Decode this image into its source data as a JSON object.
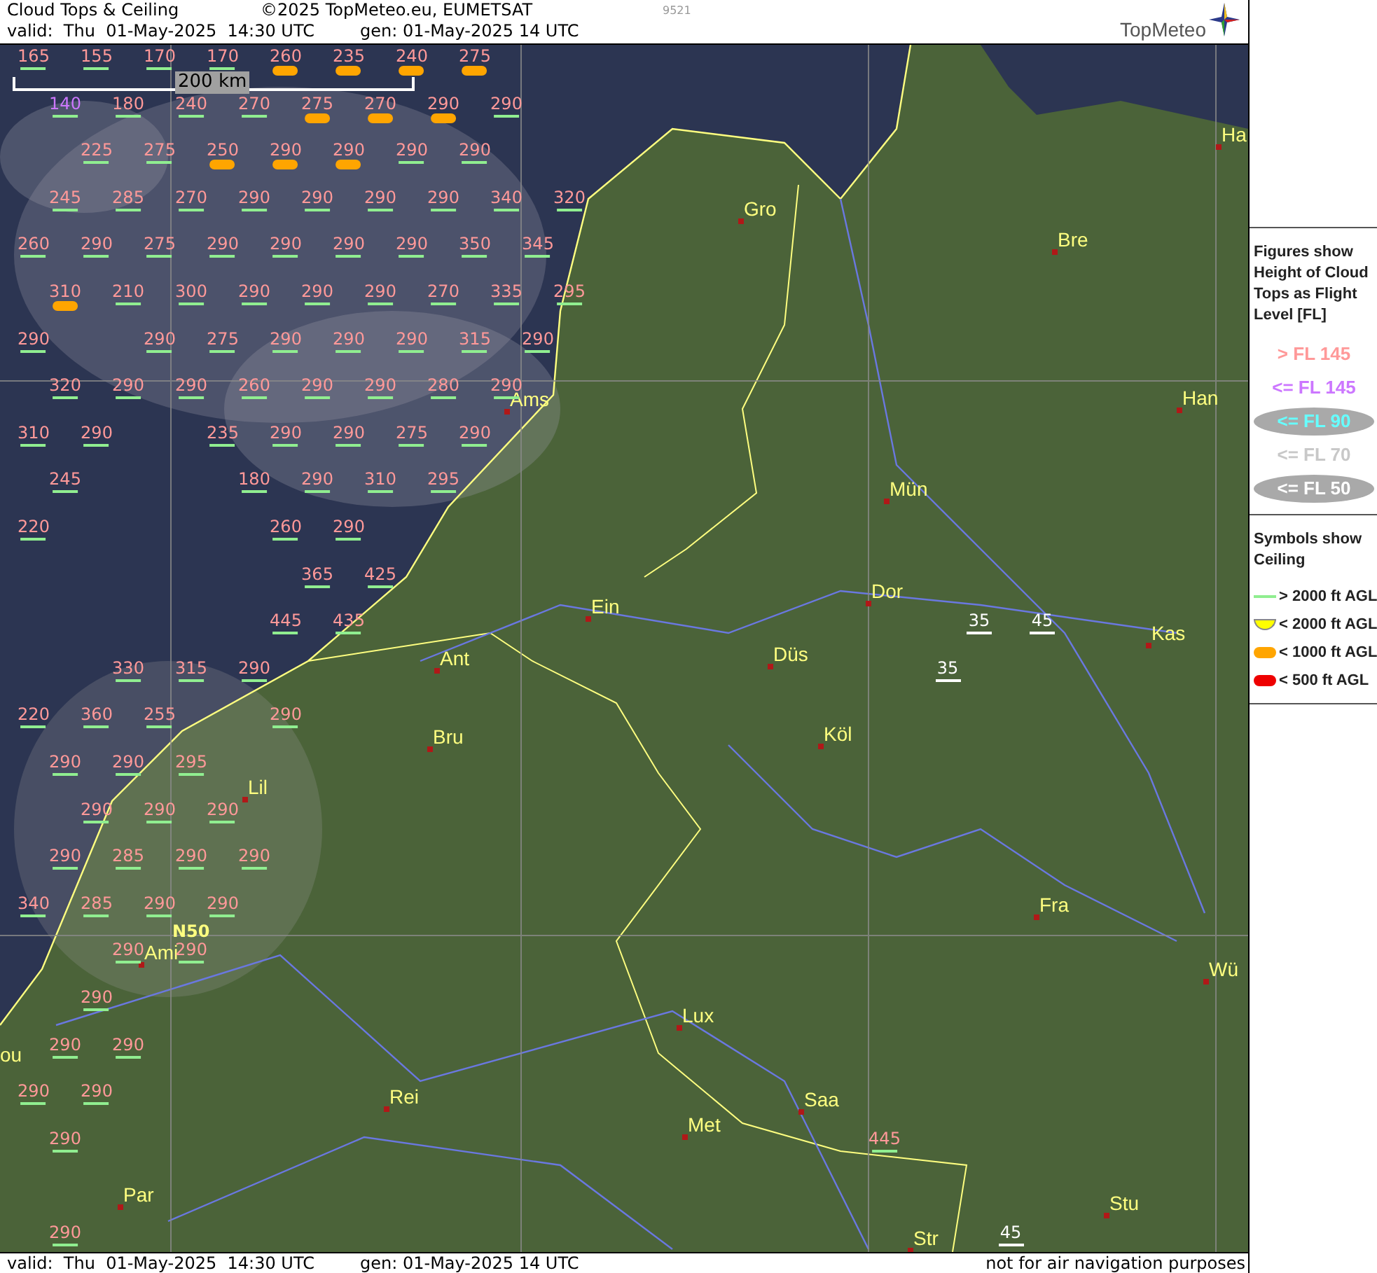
{
  "header": {
    "title": "Cloud Tops & Ceiling",
    "copyright": "©2025 TopMeteo.eu, EUMETSAT",
    "code": "9521",
    "valid": "valid:  Thu  01-May-2025  14:30 UTC",
    "generated": "gen: 01-May-2025 14 UTC",
    "logo": "TopMeteo"
  },
  "map": {
    "scale_label": "200 km",
    "grid_label": "N50",
    "cities": [
      {
        "name": "Ha"
      },
      {
        "name": "Gro"
      },
      {
        "name": "Bre"
      },
      {
        "name": "Ams"
      },
      {
        "name": "Han"
      },
      {
        "name": "Mün"
      },
      {
        "name": "Dor"
      },
      {
        "name": "Ein"
      },
      {
        "name": "Kas"
      },
      {
        "name": "Ant"
      },
      {
        "name": "Düs"
      },
      {
        "name": "Bru"
      },
      {
        "name": "Köl"
      },
      {
        "name": "Lil"
      },
      {
        "name": "Fra"
      },
      {
        "name": "Ami"
      },
      {
        "name": "Wü"
      },
      {
        "name": "Lux"
      },
      {
        "name": "ou"
      },
      {
        "name": "Saa"
      },
      {
        "name": "Rei"
      },
      {
        "name": "Met"
      },
      {
        "name": "Par"
      },
      {
        "name": "Stu"
      },
      {
        "name": "Str"
      }
    ],
    "figures": [
      {
        "fl": "165",
        "color": "#ff9999",
        "kind": "gt2000"
      },
      {
        "fl": "155",
        "color": "#ff9999",
        "kind": "gt2000"
      },
      {
        "fl": "170",
        "color": "#ff9999",
        "kind": "gt2000"
      },
      {
        "fl": "170",
        "color": "#ff9999",
        "kind": "gt2000"
      },
      {
        "fl": "260",
        "color": "#ff9999",
        "kind": "lt1000"
      },
      {
        "fl": "235",
        "color": "#ff9999",
        "kind": "lt1000"
      },
      {
        "fl": "240",
        "color": "#ff9999",
        "kind": "lt1000"
      },
      {
        "fl": "275",
        "color": "#ff9999",
        "kind": "lt1000"
      },
      {
        "fl": "140",
        "color": "#cc77ff",
        "kind": "gt2000"
      },
      {
        "fl": "180",
        "color": "#ff9999",
        "kind": "gt2000"
      },
      {
        "fl": "240",
        "color": "#ff9999",
        "kind": "gt2000"
      },
      {
        "fl": "270",
        "color": "#ff9999",
        "kind": "gt2000"
      },
      {
        "fl": "275",
        "color": "#ff9999",
        "kind": "lt1000"
      },
      {
        "fl": "270",
        "color": "#ff9999",
        "kind": "lt1000"
      },
      {
        "fl": "290",
        "color": "#ff9999",
        "kind": "lt1000"
      },
      {
        "fl": "290",
        "color": "#ff9999",
        "kind": "gt2000"
      },
      {
        "fl": "225",
        "color": "#ff9999",
        "kind": "gt2000"
      },
      {
        "fl": "275",
        "color": "#ff9999",
        "kind": "gt2000"
      },
      {
        "fl": "250",
        "color": "#ff9999",
        "kind": "lt1000"
      },
      {
        "fl": "290",
        "color": "#ff9999",
        "kind": "lt1000"
      },
      {
        "fl": "290",
        "color": "#ff9999",
        "kind": "lt1000"
      },
      {
        "fl": "290",
        "color": "#ff9999",
        "kind": "gt2000"
      },
      {
        "fl": "290",
        "color": "#ff9999",
        "kind": "gt2000"
      },
      {
        "fl": "245",
        "color": "#ff9999",
        "kind": "gt2000"
      },
      {
        "fl": "285",
        "color": "#ff9999",
        "kind": "gt2000"
      },
      {
        "fl": "270",
        "color": "#ff9999",
        "kind": "gt2000"
      },
      {
        "fl": "290",
        "color": "#ff9999",
        "kind": "gt2000"
      },
      {
        "fl": "290",
        "color": "#ff9999",
        "kind": "gt2000"
      },
      {
        "fl": "290",
        "color": "#ff9999",
        "kind": "gt2000"
      },
      {
        "fl": "290",
        "color": "#ff9999",
        "kind": "gt2000"
      },
      {
        "fl": "340",
        "color": "#ff9999",
        "kind": "gt2000"
      },
      {
        "fl": "320",
        "color": "#ff9999",
        "kind": "gt2000"
      },
      {
        "fl": "260",
        "color": "#ff9999",
        "kind": "gt2000"
      },
      {
        "fl": "290",
        "color": "#ff9999",
        "kind": "gt2000"
      },
      {
        "fl": "275",
        "color": "#ff9999",
        "kind": "gt2000"
      },
      {
        "fl": "290",
        "color": "#ff9999",
        "kind": "gt2000"
      },
      {
        "fl": "290",
        "color": "#ff9999",
        "kind": "gt2000"
      },
      {
        "fl": "290",
        "color": "#ff9999",
        "kind": "gt2000"
      },
      {
        "fl": "290",
        "color": "#ff9999",
        "kind": "gt2000"
      },
      {
        "fl": "350",
        "color": "#ff9999",
        "kind": "gt2000"
      },
      {
        "fl": "345",
        "color": "#ff9999",
        "kind": "gt2000"
      },
      {
        "fl": "310",
        "color": "#ff9999",
        "kind": "lt1000"
      },
      {
        "fl": "210",
        "color": "#ff9999",
        "kind": "gt2000"
      },
      {
        "fl": "300",
        "color": "#ff9999",
        "kind": "gt2000"
      },
      {
        "fl": "290",
        "color": "#ff9999",
        "kind": "gt2000"
      },
      {
        "fl": "290",
        "color": "#ff9999",
        "kind": "gt2000"
      },
      {
        "fl": "290",
        "color": "#ff9999",
        "kind": "gt2000"
      },
      {
        "fl": "270",
        "color": "#ff9999",
        "kind": "gt2000"
      },
      {
        "fl": "335",
        "color": "#ff9999",
        "kind": "gt2000"
      },
      {
        "fl": "295",
        "color": "#ff9999",
        "kind": "gt2000"
      },
      {
        "fl": "290",
        "color": "#ff9999",
        "kind": "gt2000"
      },
      {
        "fl": "290",
        "color": "#ff9999",
        "kind": "gt2000"
      },
      {
        "fl": "275",
        "color": "#ff9999",
        "kind": "gt2000"
      },
      {
        "fl": "290",
        "color": "#ff9999",
        "kind": "gt2000"
      },
      {
        "fl": "290",
        "color": "#ff9999",
        "kind": "gt2000"
      },
      {
        "fl": "290",
        "color": "#ff9999",
        "kind": "gt2000"
      },
      {
        "fl": "315",
        "color": "#ff9999",
        "kind": "gt2000"
      },
      {
        "fl": "290",
        "color": "#ff9999",
        "kind": "gt2000"
      },
      {
        "fl": "320",
        "color": "#ff9999",
        "kind": "gt2000"
      },
      {
        "fl": "290",
        "color": "#ff9999",
        "kind": "gt2000"
      },
      {
        "fl": "290",
        "color": "#ff9999",
        "kind": "gt2000"
      },
      {
        "fl": "260",
        "color": "#ff9999",
        "kind": "gt2000"
      },
      {
        "fl": "290",
        "color": "#ff9999",
        "kind": "gt2000"
      },
      {
        "fl": "290",
        "color": "#ff9999",
        "kind": "gt2000"
      },
      {
        "fl": "280",
        "color": "#ff9999",
        "kind": "gt2000"
      },
      {
        "fl": "290",
        "color": "#ff9999",
        "kind": "gt2000"
      },
      {
        "fl": "310",
        "color": "#ff9999",
        "kind": "gt2000"
      },
      {
        "fl": "290",
        "color": "#ff9999",
        "kind": "gt2000"
      },
      {
        "fl": "235",
        "color": "#ff9999",
        "kind": "gt2000"
      },
      {
        "fl": "290",
        "color": "#ff9999",
        "kind": "gt2000"
      },
      {
        "fl": "290",
        "color": "#ff9999",
        "kind": "gt2000"
      },
      {
        "fl": "275",
        "color": "#ff9999",
        "kind": "gt2000"
      },
      {
        "fl": "290",
        "color": "#ff9999",
        "kind": "gt2000"
      },
      {
        "fl": "245",
        "color": "#ff9999",
        "kind": "gt2000"
      },
      {
        "fl": "180",
        "color": "#ff9999",
        "kind": "gt2000"
      },
      {
        "fl": "290",
        "color": "#ff9999",
        "kind": "gt2000"
      },
      {
        "fl": "310",
        "color": "#ff9999",
        "kind": "gt2000"
      },
      {
        "fl": "295",
        "color": "#ff9999",
        "kind": "gt2000"
      },
      {
        "fl": "220",
        "color": "#ff9999",
        "kind": "gt2000"
      },
      {
        "fl": "260",
        "color": "#ff9999",
        "kind": "gt2000"
      },
      {
        "fl": "290",
        "color": "#ff9999",
        "kind": "gt2000"
      },
      {
        "fl": "365",
        "color": "#ff9999",
        "kind": "gt2000"
      },
      {
        "fl": "425",
        "color": "#ff9999",
        "kind": "gt2000"
      },
      {
        "fl": "445",
        "color": "#ff9999",
        "kind": "gt2000"
      },
      {
        "fl": "435",
        "color": "#ff9999",
        "kind": "gt2000"
      },
      {
        "fl": "35",
        "color": "#ffffff",
        "kind": "plain"
      },
      {
        "fl": "45",
        "color": "#ffffff",
        "kind": "plain"
      },
      {
        "fl": "330",
        "color": "#ff9999",
        "kind": "gt2000"
      },
      {
        "fl": "315",
        "color": "#ff9999",
        "kind": "gt2000"
      },
      {
        "fl": "290",
        "color": "#ff9999",
        "kind": "gt2000"
      },
      {
        "fl": "35",
        "color": "#ffffff",
        "kind": "plain"
      },
      {
        "fl": "220",
        "color": "#ff9999",
        "kind": "gt2000"
      },
      {
        "fl": "360",
        "color": "#ff9999",
        "kind": "gt2000"
      },
      {
        "fl": "255",
        "color": "#ff9999",
        "kind": "gt2000"
      },
      {
        "fl": "290",
        "color": "#ff9999",
        "kind": "gt2000"
      },
      {
        "fl": "290",
        "color": "#ff9999",
        "kind": "gt2000"
      },
      {
        "fl": "290",
        "color": "#ff9999",
        "kind": "gt2000"
      },
      {
        "fl": "295",
        "color": "#ff9999",
        "kind": "gt2000"
      },
      {
        "fl": "290",
        "color": "#ff9999",
        "kind": "gt2000"
      },
      {
        "fl": "290",
        "color": "#ff9999",
        "kind": "gt2000"
      },
      {
        "fl": "290",
        "color": "#ff9999",
        "kind": "gt2000"
      },
      {
        "fl": "290",
        "color": "#ff9999",
        "kind": "gt2000"
      },
      {
        "fl": "285",
        "color": "#ff9999",
        "kind": "gt2000"
      },
      {
        "fl": "290",
        "color": "#ff9999",
        "kind": "gt2000"
      },
      {
        "fl": "290",
        "color": "#ff9999",
        "kind": "gt2000"
      },
      {
        "fl": "340",
        "color": "#ff9999",
        "kind": "gt2000"
      },
      {
        "fl": "285",
        "color": "#ff9999",
        "kind": "gt2000"
      },
      {
        "fl": "290",
        "color": "#ff9999",
        "kind": "gt2000"
      },
      {
        "fl": "290",
        "color": "#ff9999",
        "kind": "gt2000"
      },
      {
        "fl": "290",
        "color": "#ff9999",
        "kind": "gt2000"
      },
      {
        "fl": "290",
        "color": "#ff9999",
        "kind": "gt2000"
      },
      {
        "fl": "290",
        "color": "#ff9999",
        "kind": "gt2000"
      },
      {
        "fl": "290",
        "color": "#ff9999",
        "kind": "gt2000"
      },
      {
        "fl": "290",
        "color": "#ff9999",
        "kind": "gt2000"
      },
      {
        "fl": "290",
        "color": "#ff9999",
        "kind": "gt2000"
      },
      {
        "fl": "290",
        "color": "#ff9999",
        "kind": "gt2000"
      },
      {
        "fl": "290",
        "color": "#ff9999",
        "kind": "gt2000"
      },
      {
        "fl": "445",
        "color": "#ff9999",
        "kind": "gt2000"
      },
      {
        "fl": "290",
        "color": "#ff9999",
        "kind": "gt2000"
      },
      {
        "fl": "45",
        "color": "#ffffff",
        "kind": "plain"
      }
    ]
  },
  "legend": {
    "figures_title": "Figures show Height of Cloud Tops as Flight Level  [FL]",
    "levels": [
      {
        "label": "> FL 145",
        "color": "#ff9999",
        "kind": "text"
      },
      {
        "label": "<= FL 145",
        "color": "#cc77ff",
        "kind": "text"
      },
      {
        "label": "<= FL 90",
        "color": "#66ffff",
        "kind": "oval"
      },
      {
        "label": "<= FL 70",
        "color": "#c8c8c8",
        "kind": "text"
      },
      {
        "label": "<= FL 50",
        "color": "#ffffff",
        "kind": "oval"
      }
    ],
    "symbols_title": "Symbols show Ceiling",
    "symbols": [
      {
        "label": "> 2000 ft AGL",
        "kind": "gt2000"
      },
      {
        "label": "< 2000 ft AGL",
        "kind": "lt2000"
      },
      {
        "label": "< 1000 ft AGL",
        "kind": "lt1000"
      },
      {
        "label": "< 500 ft AGL",
        "kind": "lt500"
      }
    ]
  },
  "footer": {
    "valid": "valid:  Thu  01-May-2025  14:30 UTC",
    "generated": "gen: 01-May-2025 14 UTC",
    "disclaimer": "not for air navigation purposes"
  }
}
